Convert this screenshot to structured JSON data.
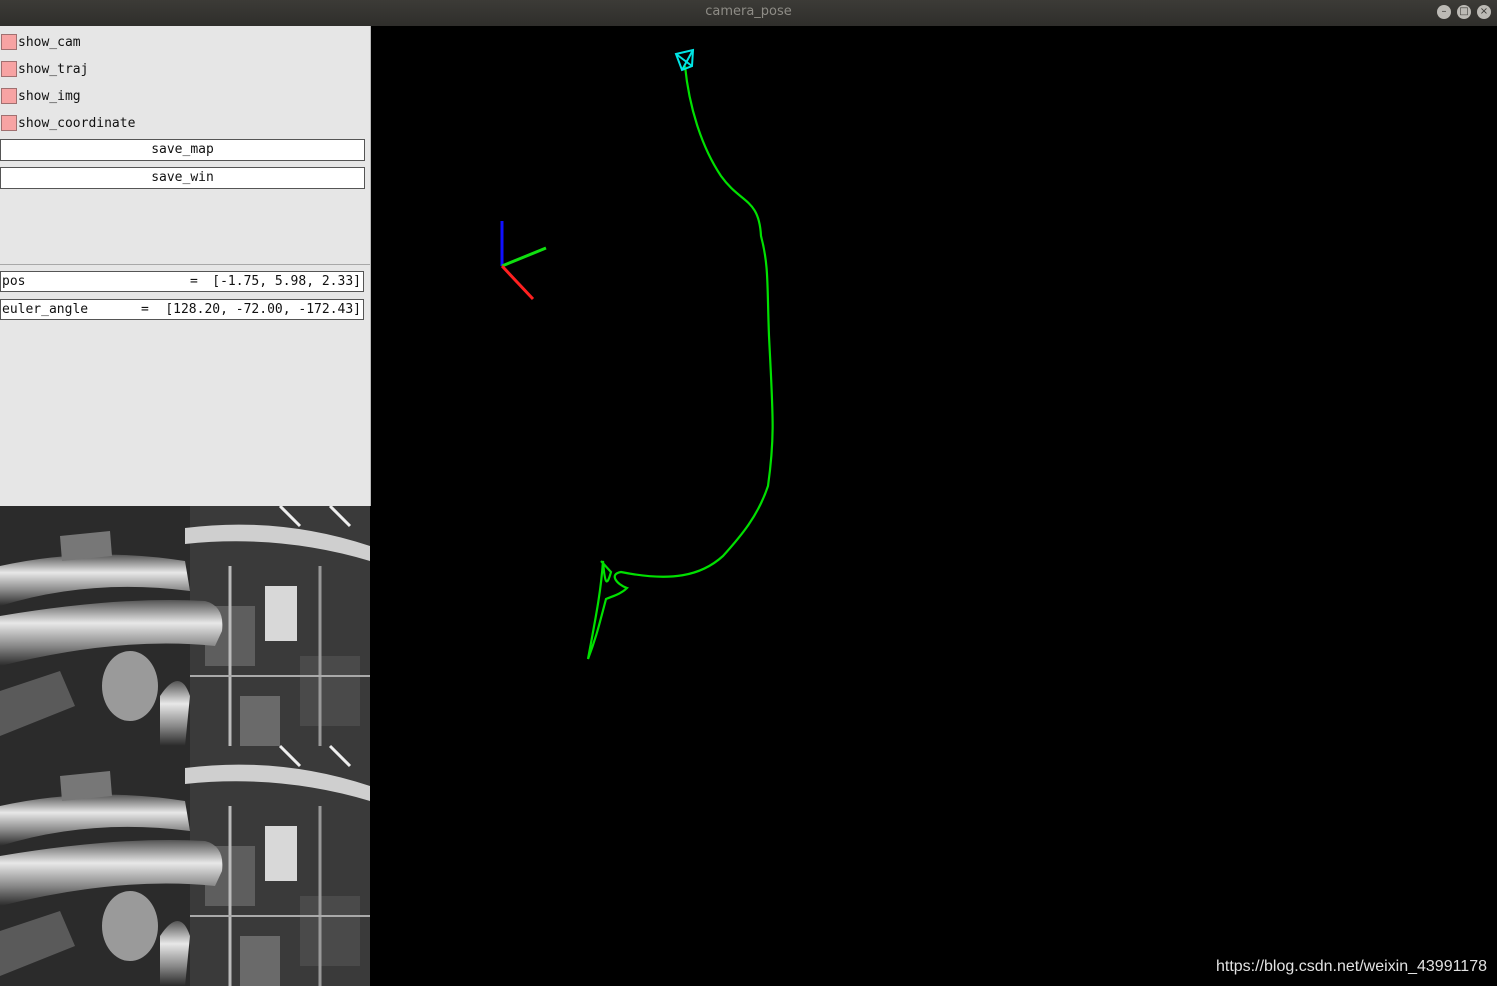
{
  "window": {
    "title": "camera_pose",
    "controls": [
      "minimize-icon",
      "maximize-icon",
      "close-icon"
    ]
  },
  "panel": {
    "checkboxes": [
      {
        "label": "show_cam",
        "checked": false
      },
      {
        "label": "show_traj",
        "checked": false
      },
      {
        "label": "show_img",
        "checked": false
      },
      {
        "label": "show_coordinate",
        "checked": false
      }
    ],
    "buttons": [
      {
        "label": "save_map"
      },
      {
        "label": "save_win"
      }
    ],
    "vars": [
      {
        "label": "pos",
        "eq": "=",
        "value": "[-1.75, 5.98, 2.33]"
      },
      {
        "label": "euler_angle",
        "eq": "=",
        "value": "[128.20, -72.00, -172.43]"
      }
    ]
  },
  "viewer": {
    "background": "#000000",
    "trajectory_color": "#00e000",
    "camera_color": "#00e5e5",
    "axis_colors": {
      "x": "#ff2020",
      "y": "#10e010",
      "z": "#1010ff"
    }
  },
  "watermark": "https://blog.csdn.net/weixin_43991178"
}
